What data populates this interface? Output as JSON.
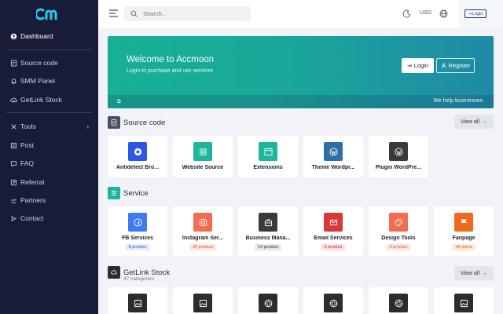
{
  "colors": {
    "sidebar_bg": "#181c38",
    "accent": "#17b094",
    "primary": "#1f3d8a"
  },
  "brand": {
    "logo_icon": "cm-logo"
  },
  "sidebar": {
    "items": [
      {
        "label": "Dashboard",
        "icon": "dashboard-icon"
      },
      {
        "label": "Source code",
        "icon": "code-file-icon"
      },
      {
        "label": "SMM Panel",
        "icon": "bell-icon"
      },
      {
        "label": "GetLink Stock",
        "icon": "cloud-download-icon"
      },
      {
        "label": "Tools",
        "icon": "tools-icon"
      },
      {
        "label": "Post",
        "icon": "post-icon"
      },
      {
        "label": "FAQ",
        "icon": "chat-icon"
      },
      {
        "label": "Referral",
        "icon": "referral-icon"
      },
      {
        "label": "Partners",
        "icon": "partners-icon"
      },
      {
        "label": "Contact",
        "icon": "contact-icon"
      }
    ]
  },
  "header": {
    "search_placeholder": "Search...",
    "currency": "USD",
    "login_label": "Login"
  },
  "banner": {
    "title": "Welcome to Accmoon",
    "subtitle": "Login to purchase and use services",
    "login_label": "Login",
    "register_label": "Register",
    "footer_left": "⧉",
    "footer_right": "We help businesses"
  },
  "sections": {
    "source_code": {
      "title": "Source code",
      "view_all": "View all",
      "cards": [
        {
          "name": "Antidetect Bro...",
          "color": "#2b56e6",
          "icon": "chrome-icon"
        },
        {
          "name": "Website Source",
          "color": "#1eb69b",
          "icon": "grid-icon"
        },
        {
          "name": "Extensions",
          "color": "#1eb69b",
          "icon": "browser-window-icon"
        },
        {
          "name": "Theme Wordpr...",
          "color": "#2f6fa6",
          "icon": "wordpress-icon"
        },
        {
          "name": "Plugin WordPre...",
          "color": "#3a3a3a",
          "icon": "wordpress-icon"
        }
      ]
    },
    "service": {
      "title": "Service",
      "cards": [
        {
          "name": "FB Services",
          "badge": "8 product",
          "color": "#3b7cf0",
          "icon": "facebook-icon",
          "badge_bg": "#e4ecfd",
          "badge_fg": "#2b5fd6"
        },
        {
          "name": "Instagram Ser...",
          "badge": "26 product",
          "color": "#f26d52",
          "icon": "instagram-icon",
          "badge_bg": "#fde6e1",
          "badge_fg": "#e0563a"
        },
        {
          "name": "Business Mana...",
          "badge": "14 product",
          "color": "#3a3a3a",
          "icon": "briefcase-icon",
          "badge_bg": "#e6e6e8",
          "badge_fg": "#333333"
        },
        {
          "name": "Email Services",
          "badge": "5 product",
          "color": "#d8383a",
          "icon": "mail-icon",
          "badge_bg": "#fbe0e0",
          "badge_fg": "#cc2f31"
        },
        {
          "name": "Design Tools",
          "badge": "5 product",
          "color": "#f26d52",
          "icon": "palette-icon",
          "badge_bg": "#fde6e1",
          "badge_fg": "#e0563a"
        },
        {
          "name": "Fanpage",
          "badge": "46 items",
          "color": "#f06a1e",
          "icon": "flag-icon",
          "badge_bg": "#fde7d9",
          "badge_fg": "#e0601a"
        }
      ]
    },
    "getlink": {
      "title": "GetLink Stock",
      "subtitle": "47 categories",
      "view_all": "View all",
      "cards": [
        {
          "color": "#2c2c2c",
          "icon": "image-icon"
        },
        {
          "color": "#2c2c2c",
          "icon": "image-icon"
        },
        {
          "color": "#2c2c2c",
          "icon": "aperture-icon"
        },
        {
          "color": "#2c2c2c",
          "icon": "aperture-icon"
        },
        {
          "color": "#2c2c2c",
          "icon": "aperture-icon"
        },
        {
          "color": "#2c2c2c",
          "icon": "image-icon"
        }
      ]
    }
  }
}
